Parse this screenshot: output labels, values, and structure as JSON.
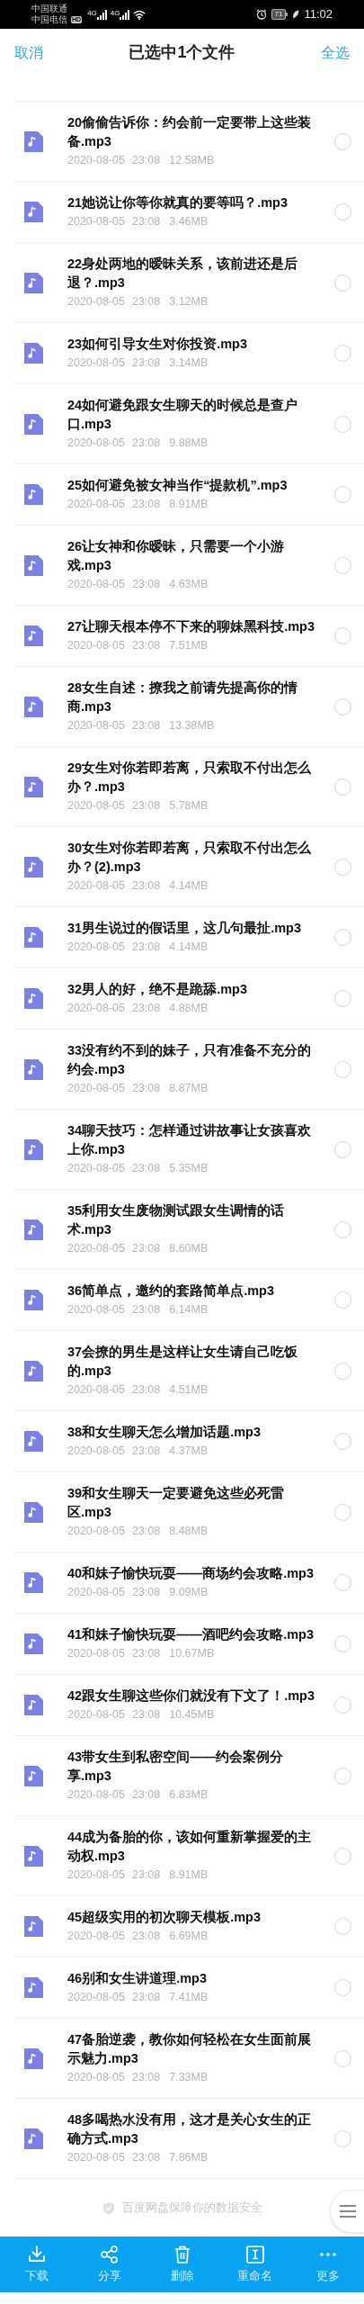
{
  "status_bar": {
    "carriers": [
      "中国联通",
      "中国电信"
    ],
    "hd": "HD",
    "networks": [
      "4G",
      "4G"
    ],
    "battery": "71",
    "time": "11:02"
  },
  "header": {
    "cancel": "取消",
    "title": "已选中1个文件",
    "select_all": "全选"
  },
  "files": [
    {
      "name": "20偷偷告诉你：约会前一定要带上这些装备.mp3",
      "date": "2020-08-05",
      "time": "23:08",
      "size": "12.58MB",
      "selected": false
    },
    {
      "name": "21她说让你等你就真的要等吗？.mp3",
      "date": "2020-08-05",
      "time": "23:08",
      "size": "3.46MB",
      "selected": false
    },
    {
      "name": "22身处两地的暧昧关系，该前进还是后退？.mp3",
      "date": "2020-08-05",
      "time": "23:08",
      "size": "3.12MB",
      "selected": false
    },
    {
      "name": "23如何引导女生对你投资.mp3",
      "date": "2020-08-05",
      "time": "23:08",
      "size": "3.14MB",
      "selected": false
    },
    {
      "name": "24如何避免跟女生聊天的时候总是查户口.mp3",
      "date": "2020-08-05",
      "time": "23:08",
      "size": "9.88MB",
      "selected": false
    },
    {
      "name": "25如何避免被女神当作“提款机”.mp3",
      "date": "2020-08-05",
      "time": "23:08",
      "size": "8.91MB",
      "selected": false
    },
    {
      "name": "26让女神和你暧昧，只需要一个小游戏.mp3",
      "date": "2020-08-05",
      "time": "23:08",
      "size": "4.63MB",
      "selected": false
    },
    {
      "name": "27让聊天根本停不下来的聊妹黑科技.mp3",
      "date": "2020-08-05",
      "time": "23:08",
      "size": "7.51MB",
      "selected": false
    },
    {
      "name": "28女生自述：撩我之前请先提高你的情商.mp3",
      "date": "2020-08-05",
      "time": "23:08",
      "size": "13.38MB",
      "selected": false
    },
    {
      "name": "29女生对你若即若离，只索取不付出怎么办？.mp3",
      "date": "2020-08-05",
      "time": "23:08",
      "size": "5.78MB",
      "selected": false
    },
    {
      "name": "30女生对你若即若离，只索取不付出怎么办？(2).mp3",
      "date": "2020-08-05",
      "time": "23:08",
      "size": "4.14MB",
      "selected": false
    },
    {
      "name": "31男生说过的假话里，这几句最扯.mp3",
      "date": "2020-08-05",
      "time": "23:08",
      "size": "4.14MB",
      "selected": false
    },
    {
      "name": "32男人的好，绝不是跪舔.mp3",
      "date": "2020-08-05",
      "time": "23:08",
      "size": "4.88MB",
      "selected": false
    },
    {
      "name": "33没有约不到的妹子，只有准备不充分的约会.mp3",
      "date": "2020-08-05",
      "time": "23:08",
      "size": "8.87MB",
      "selected": false
    },
    {
      "name": "34聊天技巧：怎样通过讲故事让女孩喜欢上你.mp3",
      "date": "2020-08-05",
      "time": "23:08",
      "size": "5.35MB",
      "selected": false
    },
    {
      "name": "35利用女生废物测试跟女生调情的话术.mp3",
      "date": "2020-08-05",
      "time": "23:08",
      "size": "8.60MB",
      "selected": false
    },
    {
      "name": "36简单点，邀约的套路简单点.mp3",
      "date": "2020-08-05",
      "time": "23:08",
      "size": "6.14MB",
      "selected": false
    },
    {
      "name": "37会撩的男生是这样让女生请自己吃饭的.mp3",
      "date": "2020-08-05",
      "time": "23:08",
      "size": "4.51MB",
      "selected": false
    },
    {
      "name": "38和女生聊天怎么增加话题.mp3",
      "date": "2020-08-05",
      "time": "23:08",
      "size": "4.37MB",
      "selected": false
    },
    {
      "name": "39和女生聊天一定要避免这些必死雷区.mp3",
      "date": "2020-08-05",
      "time": "23:08",
      "size": "8.48MB",
      "selected": false
    },
    {
      "name": "40和妹子愉快玩耍——商场约会攻略.mp3",
      "date": "2020-08-05",
      "time": "23:08",
      "size": "9.09MB",
      "selected": false
    },
    {
      "name": "41和妹子愉快玩耍——酒吧约会攻略.mp3",
      "date": "2020-08-05",
      "time": "23:08",
      "size": "10.67MB",
      "selected": false
    },
    {
      "name": "42跟女生聊这些你们就没有下文了！.mp3",
      "date": "2020-08-05",
      "time": "23:08",
      "size": "10.45MB",
      "selected": false
    },
    {
      "name": "43带女生到私密空间——约会案例分享.mp3",
      "date": "2020-08-05",
      "time": "23:08",
      "size": "6.83MB",
      "selected": false
    },
    {
      "name": "44成为备胎的你，该如何重新掌握爱的主动权.mp3",
      "date": "2020-08-05",
      "time": "23:08",
      "size": "8.91MB",
      "selected": false
    },
    {
      "name": "45超级实用的初次聊天模板.mp3",
      "date": "2020-08-05",
      "time": "23:08",
      "size": "6.69MB",
      "selected": false
    },
    {
      "name": "46别和女生讲道理.mp3",
      "date": "2020-08-05",
      "time": "23:08",
      "size": "7.41MB",
      "selected": false
    },
    {
      "name": "47备胎逆袭，教你如何轻松在女生面前展示魅力.mp3",
      "date": "2020-08-05",
      "time": "23:08",
      "size": "7.33MB",
      "selected": false
    },
    {
      "name": "48多喝热水没有用，这才是关心女生的正确方式.mp3",
      "date": "2020-08-05",
      "time": "23:08",
      "size": "7.86MB",
      "selected": false
    }
  ],
  "footer_note": "百度网盘保障你的数据安全",
  "toolbar": [
    {
      "kind": "download",
      "label": "下载"
    },
    {
      "kind": "share",
      "label": "分享"
    },
    {
      "kind": "delete",
      "label": "删除"
    },
    {
      "kind": "rename",
      "label": "重命名"
    },
    {
      "kind": "more",
      "label": "更多"
    }
  ]
}
